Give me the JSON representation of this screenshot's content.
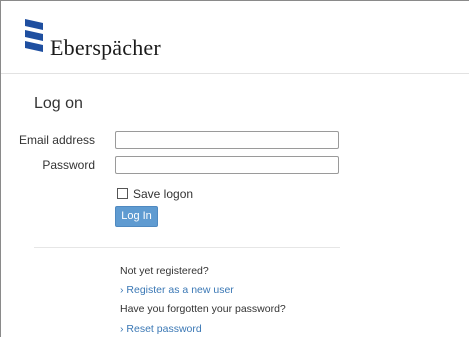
{
  "brand": {
    "name": "Eberspächer",
    "color": "#1f4fa0"
  },
  "login": {
    "title": "Log on",
    "email_label": "Email address",
    "email_value": "",
    "password_label": "Password",
    "password_value": "",
    "save_logon_label": "Save logon",
    "save_logon_checked": false,
    "login_button": "Log In"
  },
  "registration": {
    "question": "Not yet registered?",
    "link": "› Register as a new user"
  },
  "password_reset": {
    "question": "Have you forgotten your password?",
    "link": "› Reset password"
  },
  "colors": {
    "button": "#5f9bd1",
    "link": "#3b78b5"
  },
  "icons": {
    "logo": "eberspaecher-logo-icon",
    "checkbox": "checkbox-icon"
  }
}
